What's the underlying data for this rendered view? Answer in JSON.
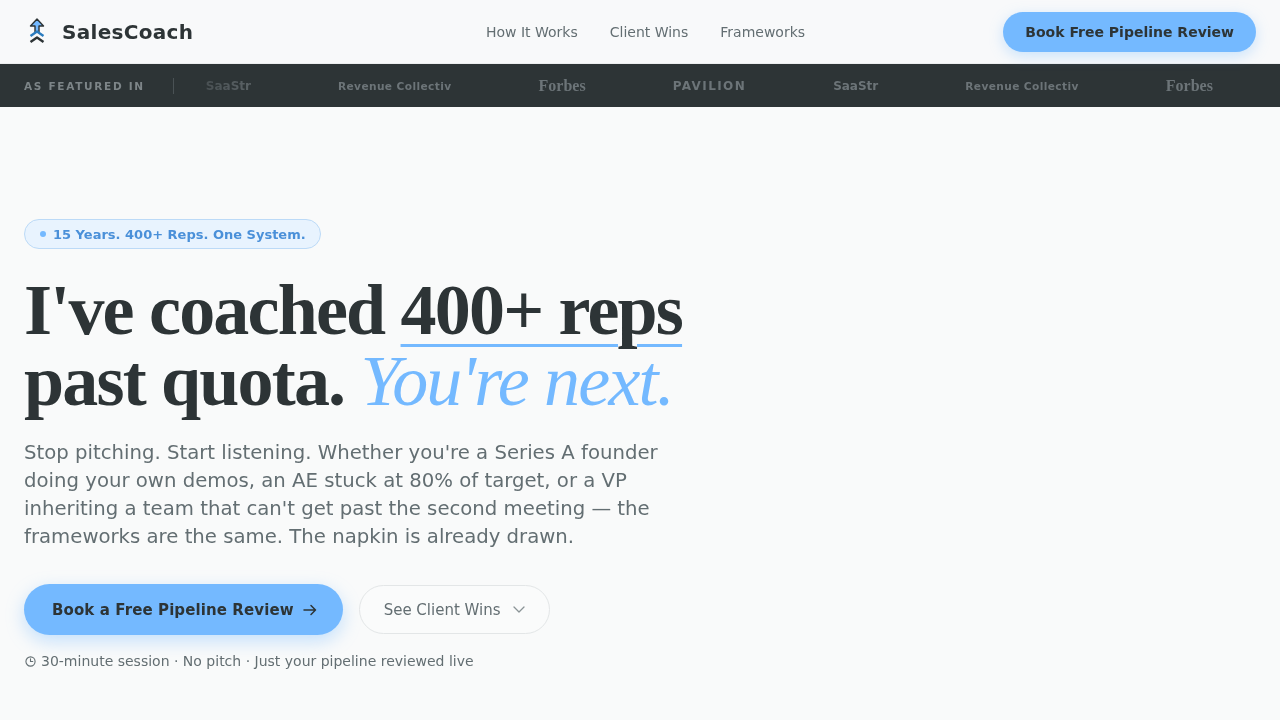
{
  "header": {
    "brand": "SalesCoach",
    "nav": [
      "How It Works",
      "Client Wins",
      "Frameworks"
    ],
    "cta": "Book Free Pipeline Review"
  },
  "featured": {
    "label": "AS FEATURED IN",
    "logos": [
      {
        "name": "SaaStr",
        "kind": "sans"
      },
      {
        "name": "Revenue Collectiv",
        "kind": "small"
      },
      {
        "name": "Forbes",
        "kind": "serif"
      },
      {
        "name": "PAVILION",
        "kind": "spaced"
      },
      {
        "name": "SaaStr",
        "kind": "sans"
      },
      {
        "name": "Revenue Collectiv",
        "kind": "small"
      },
      {
        "name": "Forbes",
        "kind": "serif"
      }
    ]
  },
  "hero": {
    "badge": "15 Years. 400+ Reps. One System.",
    "heading": {
      "lead_in": "I've coached",
      "underlined": "400+ reps",
      "line_two": "past quota.",
      "accent": "You're next."
    },
    "lead": "Stop pitching. Start listening. Whether you're a Series A founder doing your own demos, an AE stuck at 80% of target, or a VP inheriting a team that can't get past the second meeting — the frameworks are the same. The napkin is already drawn.",
    "primary_cta": "Book a Free Pipeline Review",
    "secondary_cta": "See Client Wins",
    "note": "30-minute session · No pitch · Just your pipeline reviewed live"
  }
}
